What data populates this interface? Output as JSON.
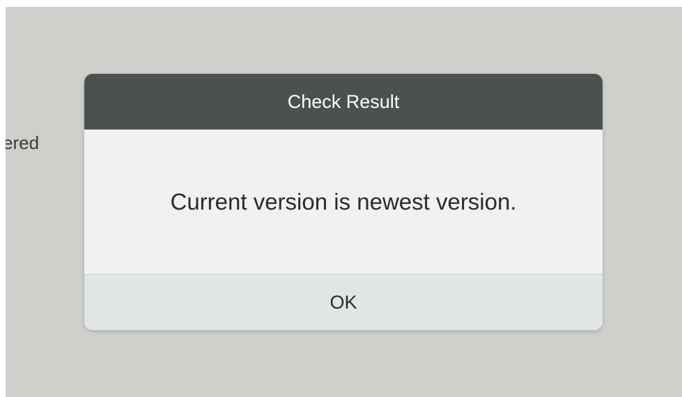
{
  "background": {
    "partial_text": "ered"
  },
  "dialog": {
    "title": "Check Result",
    "message": "Current version is newest version.",
    "ok_label": "OK"
  },
  "colors": {
    "screen_background": "#cfcfcc",
    "header_background": "#4c504f",
    "body_background": "#f1f2f0",
    "footer_background": "#e0e5e6"
  }
}
